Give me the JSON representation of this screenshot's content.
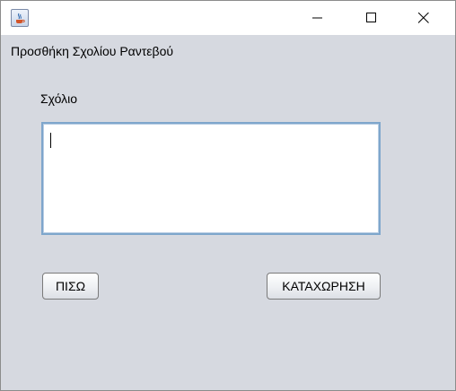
{
  "window": {
    "title": "",
    "icon": "java-icon",
    "controls": [
      "minimize-icon",
      "maximize-icon",
      "close-icon"
    ]
  },
  "form": {
    "header": "Προσθήκη Σχολίου Ραντεβού",
    "comment_label": "Σχόλιο",
    "comment_value": ""
  },
  "buttons": {
    "back_label": "ΠΙΣΩ",
    "submit_label": "ΚΑΤΑΧΩΡΗΣΗ"
  },
  "colors": {
    "background": "#d6d9e0",
    "focus_border": "#7ea6cc"
  }
}
